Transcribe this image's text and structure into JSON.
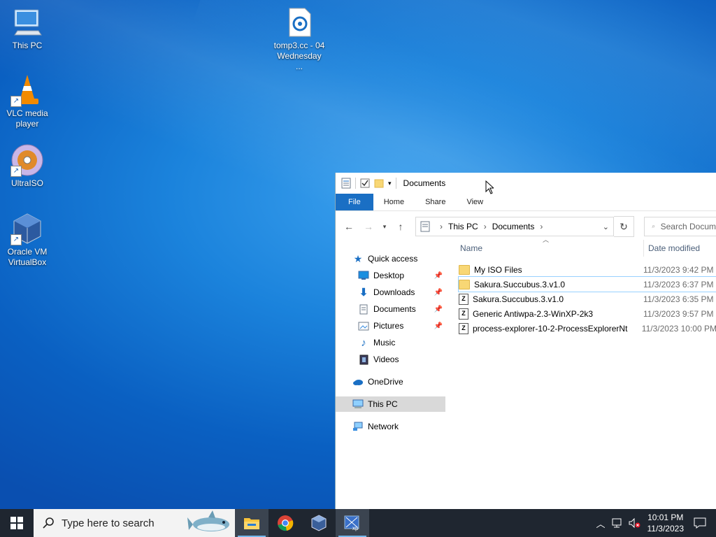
{
  "desktop": {
    "icons": [
      {
        "label": "This PC"
      },
      {
        "label": "tomp3.cc - 04 Wednesday ..."
      },
      {
        "label": "VLC media player"
      },
      {
        "label": "UltraISO"
      },
      {
        "label": "Oracle VM VirtualBox"
      }
    ]
  },
  "explorer": {
    "title": "Documents",
    "ribbon_tabs": [
      "File",
      "Home",
      "Share",
      "View"
    ],
    "breadcrumb": [
      "This PC",
      "Documents"
    ],
    "search_placeholder": "Search Docum",
    "nav": {
      "quick_access": "Quick access",
      "items": [
        "Desktop",
        "Downloads",
        "Documents",
        "Pictures",
        "Music",
        "Videos"
      ],
      "onedrive": "OneDrive",
      "this_pc": "This PC",
      "network": "Network"
    },
    "columns": {
      "name": "Name",
      "date": "Date modified"
    },
    "files": [
      {
        "name": "My ISO Files",
        "date": "11/3/2023 9:42 PM",
        "type": "folder"
      },
      {
        "name": "Sakura.Succubus.3.v1.0",
        "date": "11/3/2023 6:37 PM",
        "type": "folder"
      },
      {
        "name": "Sakura.Succubus.3.v1.0",
        "date": "11/3/2023 6:35 PM",
        "type": "zip"
      },
      {
        "name": "Generic Antiwpa-2.3-WinXP-2k3",
        "date": "11/3/2023 9:57 PM",
        "type": "zip"
      },
      {
        "name": "process-explorer-10-2-ProcessExplorerNt",
        "date": "11/3/2023 10:00 PM",
        "type": "zip"
      }
    ]
  },
  "taskbar": {
    "search_placeholder": "Type here to search",
    "time": "10:01 PM",
    "date": "11/3/2023"
  },
  "colors": {
    "accent": "#1a6fc4",
    "taskbar": "#1f2630",
    "desktop": "#0a60c2"
  }
}
